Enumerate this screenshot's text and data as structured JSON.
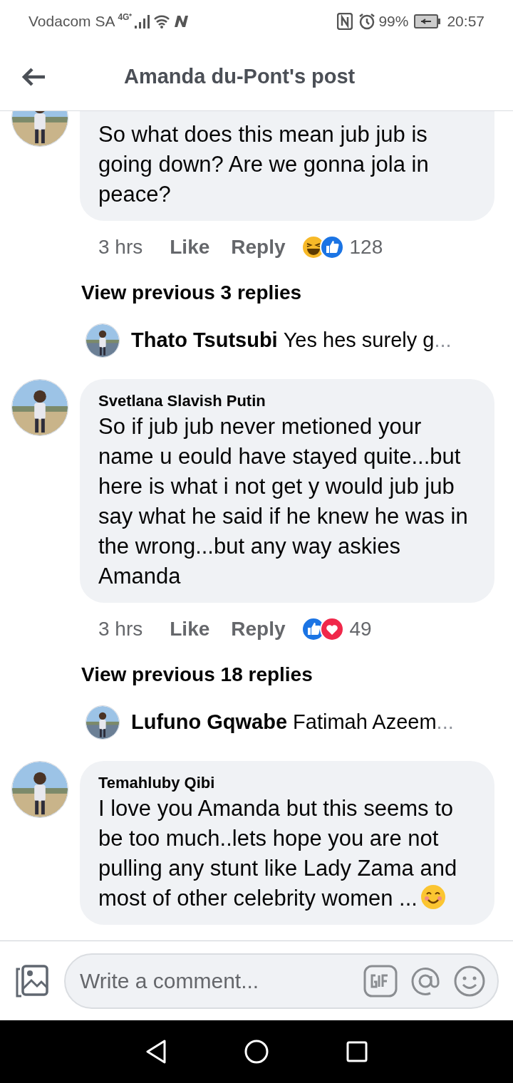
{
  "status_bar": {
    "carrier": "Vodacom SA",
    "network": "4G⁺",
    "battery": "99%",
    "time": "20:57"
  },
  "header": {
    "title": "Amanda du-Pont's post"
  },
  "feed": [
    {
      "kind": "comment",
      "text": "So what does this mean jub jub is going down? Are we gonna jola in peace?",
      "time": "3 hrs",
      "like": "Like",
      "reply": "Reply",
      "reactions": [
        {
          "kind": "haha"
        },
        {
          "kind": "like"
        }
      ],
      "count": "128"
    },
    {
      "kind": "more",
      "label": "View previous 3 replies"
    },
    {
      "kind": "preview",
      "name": "Thato Tsutsubi",
      "snippet": "Yes hes surely g",
      "ellipsis": "..."
    },
    {
      "kind": "comment",
      "author": "Svetlana Slavish Putin",
      "text": "So if jub jub never metioned your name u eould have stayed quite...but here is what i not get y would jub jub say what he said if he knew he was in the wrong...but any way askies Amanda",
      "time": "3 hrs",
      "like": "Like",
      "reply": "Reply",
      "reactions": [
        {
          "kind": "like"
        },
        {
          "kind": "love"
        }
      ],
      "count": "49"
    },
    {
      "kind": "more",
      "label": "View previous 18 replies"
    },
    {
      "kind": "preview",
      "name": "Lufuno Gqwabe",
      "snippet": "Fatimah Azeem",
      "ellipsis": "..."
    },
    {
      "kind": "comment",
      "author": "Temahluby Qibi",
      "text": "I love you Amanda but this seems to be too much..lets hope you are not pulling any stunt like Lady Zama and most of other celebrity women ...",
      "emoji": {
        "kind": "smile"
      }
    }
  ],
  "composer": {
    "placeholder": "Write a comment..."
  }
}
